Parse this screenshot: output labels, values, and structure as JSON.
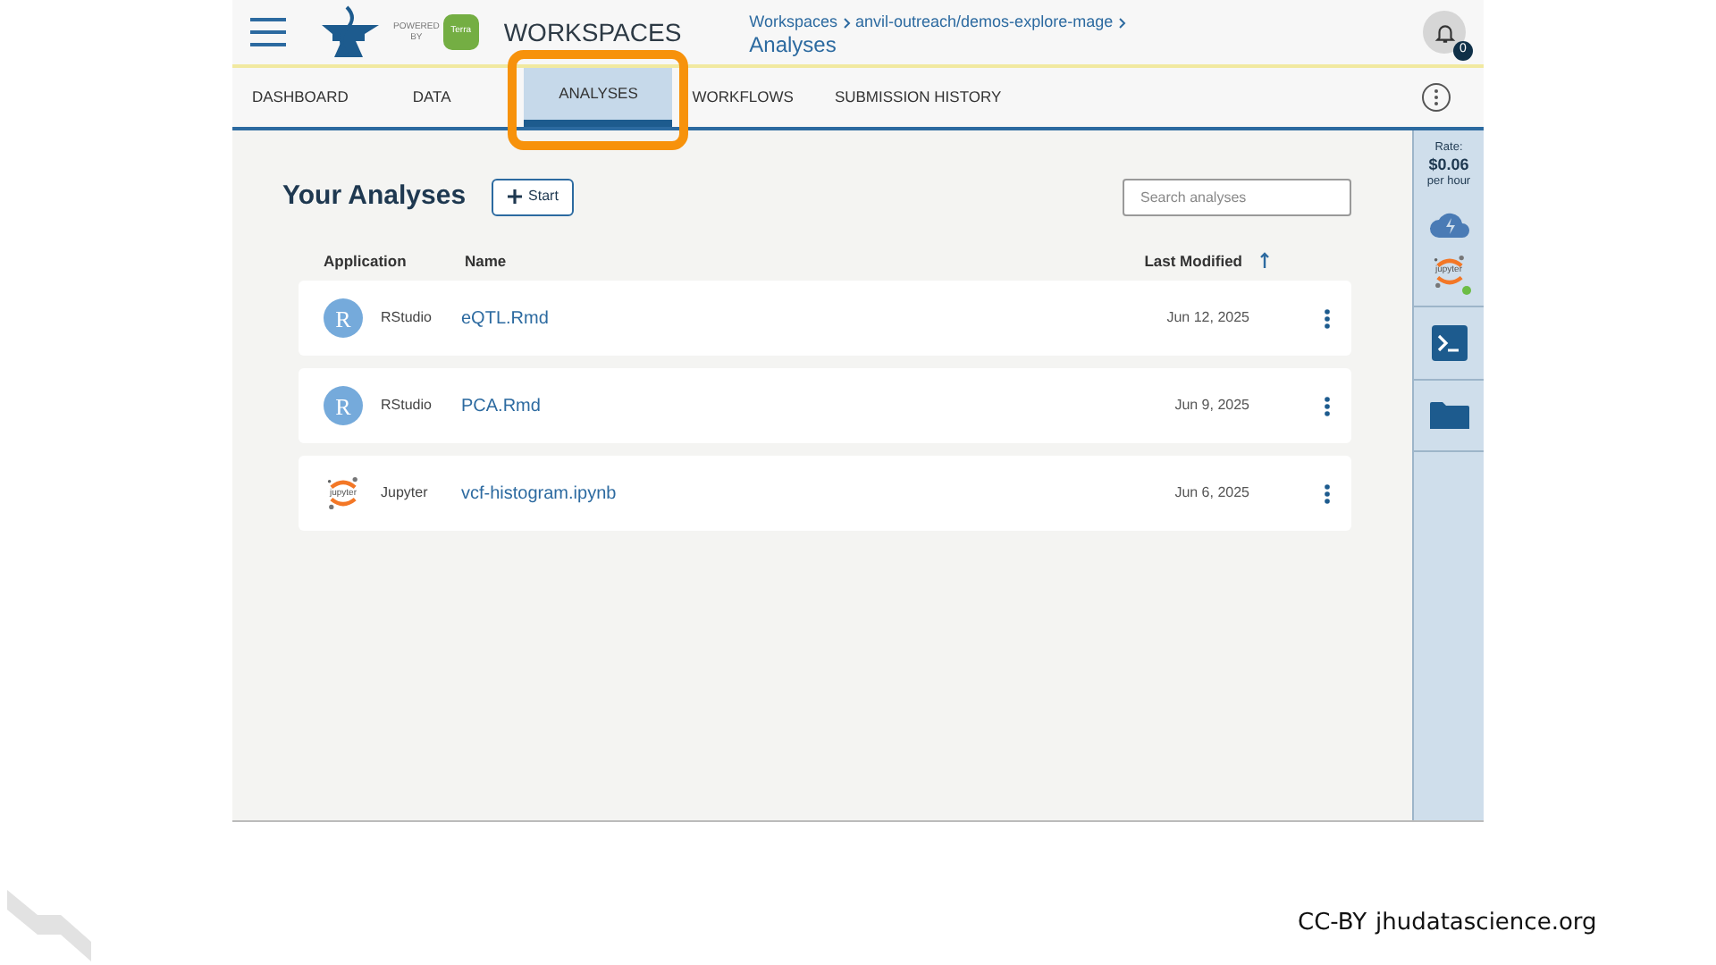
{
  "header": {
    "powered_by": [
      "POWERED",
      "BY"
    ],
    "terra_logo": "Terra",
    "title": "WORKSPACES",
    "breadcrumb": [
      "Workspaces",
      "anvil-outreach/demos-explore-mage"
    ],
    "page_title": "Analyses",
    "notifications": "0"
  },
  "tabs": [
    {
      "label": "DASHBOARD",
      "selected": false
    },
    {
      "label": "DATA",
      "selected": false
    },
    {
      "label": "ANALYSES",
      "selected": true
    },
    {
      "label": "WORKFLOWS",
      "selected": false
    },
    {
      "label": "SUBMISSION HISTORY",
      "selected": false
    }
  ],
  "analyses": {
    "title": "Your Analyses",
    "start_button": "Start",
    "search": {
      "placeholder": "Search analyses"
    },
    "columns": [
      "Application",
      "Name",
      "Last Modified"
    ],
    "rows": [
      {
        "kind": "rstudio",
        "logo": "R",
        "app": "RStudio",
        "name": "eQTL.Rmd",
        "modified": "Jun 12, 2025"
      },
      {
        "kind": "rstudio",
        "logo": "R",
        "app": "RStudio",
        "name": "PCA.Rmd",
        "modified": "Jun 9, 2025"
      },
      {
        "kind": "jupyter",
        "logo": "jupyter",
        "app": "Jupyter",
        "name": "vcf-histogram.ipynb",
        "modified": "Jun 6, 2025"
      }
    ]
  },
  "side_panel": {
    "rate_label": "Rate:",
    "rate": "$0.06",
    "rate_unit": "per hour",
    "jupyter_logo": "jupyter"
  },
  "footer": {
    "license": "CC-BY",
    "site": "jhudatascience.org"
  }
}
